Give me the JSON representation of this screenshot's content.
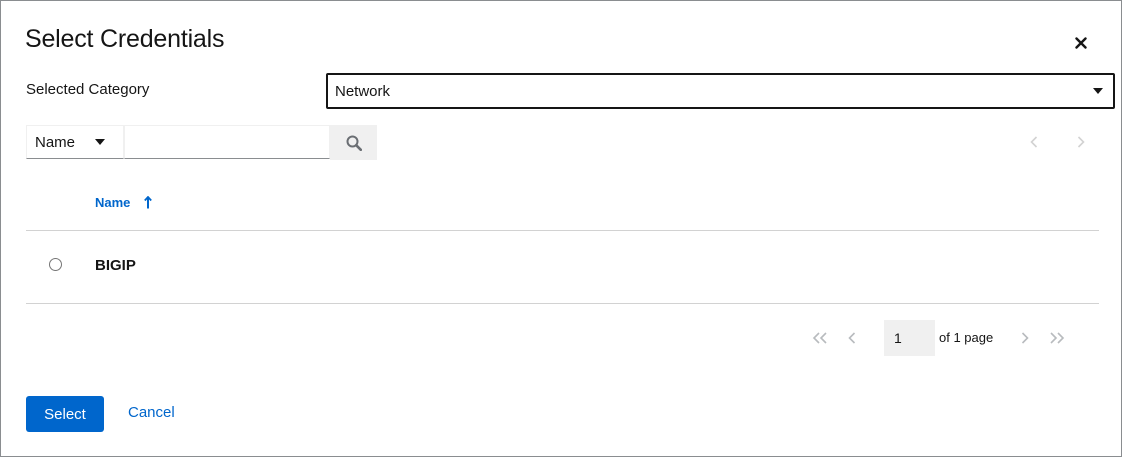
{
  "modal": {
    "title": "Select Credentials",
    "close_icon": "close-icon"
  },
  "category": {
    "label": "Selected Category",
    "selected": "Network"
  },
  "toolbar": {
    "filter_field": "Name",
    "search_value": "",
    "search_icon": "search-icon"
  },
  "table": {
    "columns": [
      {
        "label": "Name",
        "sort": "ascending"
      }
    ],
    "rows": [
      {
        "name": "BIGIP",
        "selected": false
      }
    ]
  },
  "pagination": {
    "page": "1",
    "of_label": "of 1 page"
  },
  "footer": {
    "select_label": "Select",
    "cancel_label": "Cancel"
  },
  "colors": {
    "primary": "#0066cc",
    "disabled": "#d2d2d2",
    "text": "#151515"
  }
}
